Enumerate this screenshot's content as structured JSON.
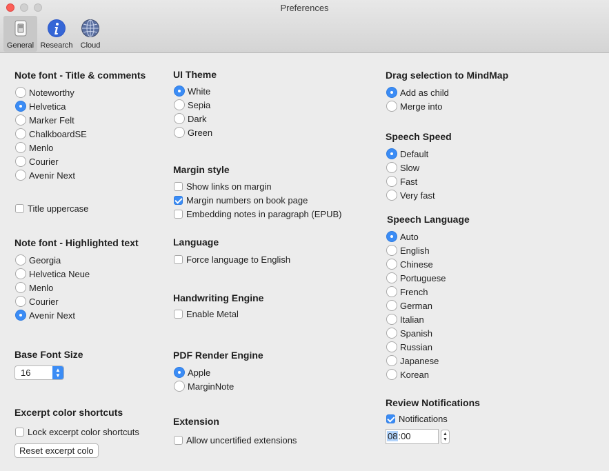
{
  "window": {
    "title": "Preferences"
  },
  "toolbar": {
    "tabs": [
      {
        "label": "General",
        "icon": "switch-icon"
      },
      {
        "label": "Research",
        "icon": "info-icon"
      },
      {
        "label": "Cloud",
        "icon": "globe-icon"
      }
    ]
  },
  "colors": {
    "accent": "#3b8cf5",
    "close": "#fc5f57"
  },
  "note_font_title": {
    "heading": "Note font - Title & comments",
    "options": [
      "Noteworthy",
      "Helvetica",
      "Marker Felt",
      "ChalkboardSE",
      "Menlo",
      "Courier",
      "Avenir Next"
    ],
    "selected": "Helvetica",
    "title_uppercase": {
      "label": "Title uppercase",
      "checked": false
    }
  },
  "note_font_highlight": {
    "heading": "Note font - Highlighted text",
    "options": [
      "Georgia",
      "Helvetica Neue",
      "Menlo",
      "Courier",
      "Avenir Next"
    ],
    "selected": "Avenir Next"
  },
  "base_font_size": {
    "heading": "Base Font Size",
    "value": "16"
  },
  "excerpt_shortcuts": {
    "heading": "Excerpt color shortcuts",
    "lock": {
      "label": "Lock excerpt color shortcuts",
      "checked": false
    },
    "reset_label": "Reset excerpt colo"
  },
  "ui_theme": {
    "heading": "UI Theme",
    "options": [
      "White",
      "Sepia",
      "Dark",
      "Green"
    ],
    "selected": "White"
  },
  "margin_style": {
    "heading": "Margin style",
    "options": [
      {
        "label": "Show links on margin",
        "checked": false
      },
      {
        "label": "Margin numbers on book page",
        "checked": true
      },
      {
        "label": "Embedding notes in paragraph (EPUB)",
        "checked": false
      }
    ]
  },
  "language": {
    "heading": "Language",
    "force": {
      "label": "Force language to English",
      "checked": false
    }
  },
  "handwriting": {
    "heading": "Handwriting Engine",
    "metal": {
      "label": "Enable Metal",
      "checked": false
    }
  },
  "pdf_engine": {
    "heading": "PDF Render Engine",
    "options": [
      "Apple",
      "MarginNote"
    ],
    "selected": "Apple"
  },
  "extension": {
    "heading": "Extension",
    "allow": {
      "label": "Allow uncertified extensions",
      "checked": false
    }
  },
  "drag_selection": {
    "heading": "Drag selection to MindMap",
    "options": [
      "Add as child",
      "Merge into"
    ],
    "selected": "Add as child"
  },
  "speech_speed": {
    "heading": "Speech Speed",
    "options": [
      "Default",
      "Slow",
      "Fast",
      "Very fast"
    ],
    "selected": "Default"
  },
  "speech_language": {
    "heading": "Speech Language",
    "options": [
      "Auto",
      "English",
      "Chinese",
      "Portuguese",
      "French",
      "German",
      "Italian",
      "Spanish",
      "Russian",
      "Japanese",
      "Korean"
    ],
    "selected": "Auto"
  },
  "review_notifications": {
    "heading": "Review Notifications",
    "notifications": {
      "label": "Notifications",
      "checked": true
    },
    "time_hours": "08",
    "time_rest": ":00"
  }
}
